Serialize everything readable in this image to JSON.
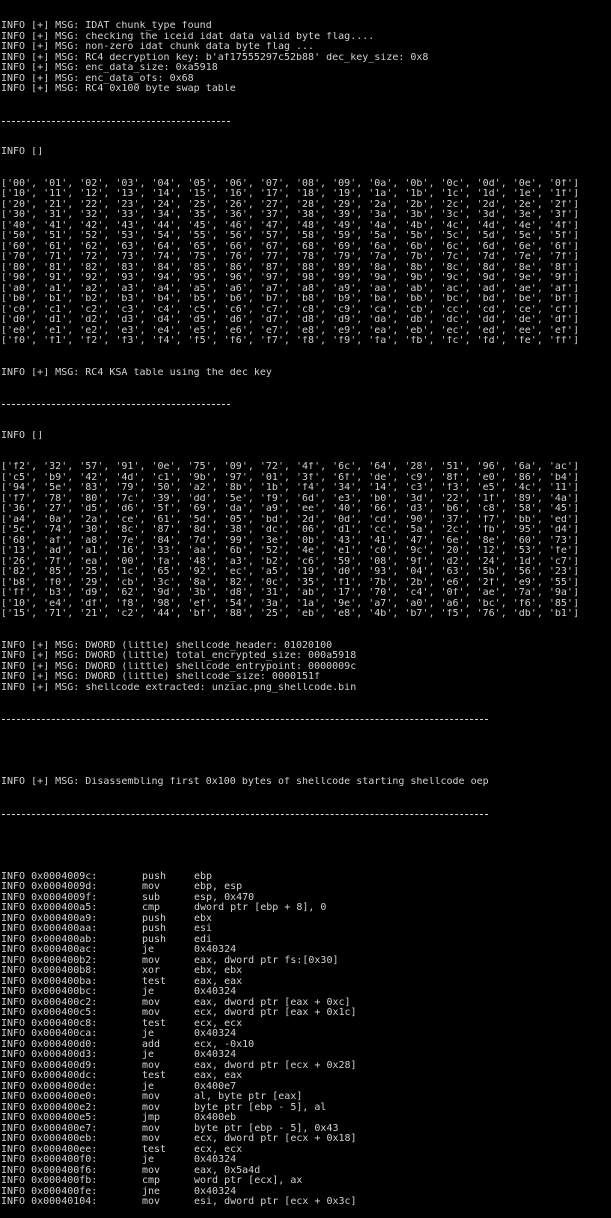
{
  "log_top": [
    "INFO [+] MSG: IDAT chunk_type found",
    "INFO [+] MSG: checking the iceid idat data valid byte flag....",
    "INFO [+] MSG: non-zero idat chunk data byte flag ...",
    "INFO [+] MSG: RC4 decryption key: b'af17555297c52b88' dec_key_size: 0x8",
    "INFO [+] MSG: enc_data_size: 0xa5918",
    "INFO [+] MSG: enc_data_ofs: 0x68",
    "INFO [+] MSG: RC4 0x100 byte swap table"
  ],
  "swap_table_header": "INFO []",
  "swap_table": [
    "['00', '01', '02', '03', '04', '05', '06', '07', '08', '09', '0a', '0b', '0c', '0d', '0e', '0f']",
    "['10', '11', '12', '13', '14', '15', '16', '17', '18', '19', '1a', '1b', '1c', '1d', '1e', '1f']",
    "['20', '21', '22', '23', '24', '25', '26', '27', '28', '29', '2a', '2b', '2c', '2d', '2e', '2f']",
    "['30', '31', '32', '33', '34', '35', '36', '37', '38', '39', '3a', '3b', '3c', '3d', '3e', '3f']",
    "['40', '41', '42', '43', '44', '45', '46', '47', '48', '49', '4a', '4b', '4c', '4d', '4e', '4f']",
    "['50', '51', '52', '53', '54', '55', '56', '57', '58', '59', '5a', '5b', '5c', '5d', '5e', '5f']",
    "['60', '61', '62', '63', '64', '65', '66', '67', '68', '69', '6a', '6b', '6c', '6d', '6e', '6f']",
    "['70', '71', '72', '73', '74', '75', '76', '77', '78', '79', '7a', '7b', '7c', '7d', '7e', '7f']",
    "['80', '81', '82', '83', '84', '85', '86', '87', '88', '89', '8a', '8b', '8c', '8d', '8e', '8f']",
    "['90', '91', '92', '93', '94', '95', '96', '97', '98', '99', '9a', '9b', '9c', '9d', '9e', '9f']",
    "['a0', 'a1', 'a2', 'a3', 'a4', 'a5', 'a6', 'a7', 'a8', 'a9', 'aa', 'ab', 'ac', 'ad', 'ae', 'af']",
    "['b0', 'b1', 'b2', 'b3', 'b4', 'b5', 'b6', 'b7', 'b8', 'b9', 'ba', 'bb', 'bc', 'bd', 'be', 'bf']",
    "['c0', 'c1', 'c2', 'c3', 'c4', 'c5', 'c6', 'c7', 'c8', 'c9', 'ca', 'cb', 'cc', 'cd', 'ce', 'cf']",
    "['d0', 'd1', 'd2', 'd3', 'd4', 'd5', 'd6', 'd7', 'd8', 'd9', 'da', 'db', 'dc', 'dd', 'de', 'df']",
    "['e0', 'e1', 'e2', 'e3', 'e4', 'e5', 'e6', 'e7', 'e8', 'e9', 'ea', 'eb', 'ec', 'ed', 'ee', 'ef']",
    "['f0', 'f1', 'f2', 'f3', 'f4', 'f5', 'f6', 'f7', 'f8', 'f9', 'fa', 'fb', 'fc', 'fd', 'fe', 'ff']"
  ],
  "ksa_msg": "INFO [+] MSG: RC4 KSA table using the dec key",
  "ksa_table_header": "INFO []",
  "ksa_table": [
    "['f2', '32', '57', '91', '0e', '75', '09', '72', '4f', '6c', '64', '28', '51', '96', '6a', 'ac']",
    "['c5', 'b9', '42', '4d', 'c1', '9b', '97', '01', '3f', '6f', 'de', 'c9', '8f', 'e0', '86', 'b4']",
    "['94', '5e', '83', '79', '50', 'a2', '8b', '1b', 'f4', '34', '14', 'c3', 'f3', 'e5', '4c', '11']",
    "['f7', '78', '80', '7c', '39', 'dd', '5e', 'f9', '6d', 'e3', 'b0', '3d', '22', '1f', '89', '4a']",
    "['36', '27', 'd5', 'd6', '5f', '69', 'da', 'a9', 'ee', '40', '66', 'd3', 'b6', 'c8', '58', '45']",
    "['a4', '0a', '2a', 'ce', '61', '5d', '05', 'bd', '2d', '0d', 'cd', '90', '37', 'f7', 'bb', 'ed']",
    "['5c', '74', '30', '8c', '87', '8d', '38', 'dc', '06', 'd1', 'cc', '5a', '2c', 'fb', '95', 'd4']",
    "['68', 'af', 'a8', '7e', '84', '7d', '99', '3e', '0b', '43', '41', '47', '6e', '8e', '60', '73']",
    "['13', 'ad', 'a1', '16', '33', 'aa', '6b', '52', '4e', 'e1', 'c0', '9c', '20', '12', '53', 'fe']",
    "['26', '7f', 'ea', '00', 'fa', '48', 'a3', 'b2', 'c6', '59', '08', '9f', 'd2', '24', '1d', 'c7']",
    "['82', '85', '25', '1c', '65', '92', 'ec', 'a5', '19', 'd0', '93', '04', '63', '5b', '56', '23']",
    "['b8', 'f0', '29', 'cb', '3c', '8a', '82', '0c', '35', 'f1', '7b', '2b', 'e6', '2f', 'e9', '55']",
    "['ff', 'b3', 'd9', '62', '9d', '3b', 'd8', '31', 'ab', '17', '70', 'c4', '0f', 'ae', '7a', '9a']",
    "['10', 'e4', 'df', 'f8', '98', 'ef', '54', '3a', '1a', '9e', 'a7', 'a0', 'a6', 'bc', 'f6', '85']",
    "['15', '71', '21', 'c2', '44', 'bf', '88', '25', 'eb', 'e8', '4b', 'b7', 'f5', '76', 'db', 'b1']"
  ],
  "log_dwords": [
    "INFO [+] MSG: DWORD (little) shellcode_header: 01020100",
    "INFO [+] MSG: DWORD (little) total_encrypted_size: 000a5918",
    "INFO [+] MSG: DWORD (little) shellcode_entrypoint: 0000009c",
    "INFO [+] MSG: DWORD (little) shellcode_size: 0000151f",
    "INFO [+] MSG: shellcode extracted: unziac.png_shellcode.bin"
  ],
  "disasm_msg": "INFO [+] MSG: Disassembling first 0x100 bytes of shellcode starting shellcode oep",
  "disasm": [
    {
      "addr": "INFO 0x0004009c:",
      "op": "push",
      "args": "ebp"
    },
    {
      "addr": "INFO 0x0004009d:",
      "op": "mov",
      "args": "ebp, esp"
    },
    {
      "addr": "INFO 0x0004009f:",
      "op": "sub",
      "args": "esp, 0x470"
    },
    {
      "addr": "INFO 0x000400a5:",
      "op": "cmp",
      "args": "dword ptr [ebp + 8], 0"
    },
    {
      "addr": "INFO 0x000400a9:",
      "op": "push",
      "args": "ebx"
    },
    {
      "addr": "INFO 0x000400aa:",
      "op": "push",
      "args": "esi"
    },
    {
      "addr": "INFO 0x000400ab:",
      "op": "push",
      "args": "edi"
    },
    {
      "addr": "INFO 0x000400ac:",
      "op": "je",
      "args": "0x40324"
    },
    {
      "addr": "INFO 0x000400b2:",
      "op": "mov",
      "args": "eax, dword ptr fs:[0x30]"
    },
    {
      "addr": "INFO 0x000400b8:",
      "op": "xor",
      "args": "ebx, ebx"
    },
    {
      "addr": "INFO 0x000400ba:",
      "op": "test",
      "args": "eax, eax"
    },
    {
      "addr": "INFO 0x000400bc:",
      "op": "je",
      "args": "0x40324"
    },
    {
      "addr": "INFO 0x000400c2:",
      "op": "mov",
      "args": "eax, dword ptr [eax + 0xc]"
    },
    {
      "addr": "INFO 0x000400c5:",
      "op": "mov",
      "args": "ecx, dword ptr [eax + 0x1c]"
    },
    {
      "addr": "INFO 0x000400c8:",
      "op": "test",
      "args": "ecx, ecx"
    },
    {
      "addr": "INFO 0x000400ca:",
      "op": "je",
      "args": "0x40324"
    },
    {
      "addr": "INFO 0x000400d0:",
      "op": "add",
      "args": "ecx, -0x10"
    },
    {
      "addr": "INFO 0x000400d3:",
      "op": "je",
      "args": "0x40324"
    },
    {
      "addr": "INFO 0x000400d9:",
      "op": "mov",
      "args": "eax, dword ptr [ecx + 0x28]"
    },
    {
      "addr": "INFO 0x000400dc:",
      "op": "test",
      "args": "eax, eax"
    },
    {
      "addr": "INFO 0x000400de:",
      "op": "je",
      "args": "0x400e7"
    },
    {
      "addr": "INFO 0x000400e0:",
      "op": "mov",
      "args": "al, byte ptr [eax]"
    },
    {
      "addr": "INFO 0x000400e2:",
      "op": "mov",
      "args": "byte ptr [ebp - 5], al"
    },
    {
      "addr": "INFO 0x000400e5:",
      "op": "jmp",
      "args": "0x400eb"
    },
    {
      "addr": "INFO 0x000400e7:",
      "op": "mov",
      "args": "byte ptr [ebp - 5], 0x43"
    },
    {
      "addr": "INFO 0x000400eb:",
      "op": "mov",
      "args": "ecx, dword ptr [ecx + 0x18]"
    },
    {
      "addr": "INFO 0x000400ee:",
      "op": "test",
      "args": "ecx, ecx"
    },
    {
      "addr": "INFO 0x000400f0:",
      "op": "je",
      "args": "0x40324"
    },
    {
      "addr": "INFO 0x000400f6:",
      "op": "mov",
      "args": "eax, 0x5a4d"
    },
    {
      "addr": "INFO 0x000400fb:",
      "op": "cmp",
      "args": "word ptr [ecx], ax"
    },
    {
      "addr": "INFO 0x000400fe:",
      "op": "jne",
      "args": "0x40324"
    },
    {
      "addr": "INFO 0x00040104:",
      "op": "mov",
      "args": "esi, dword ptr [ecx + 0x3c]"
    }
  ]
}
